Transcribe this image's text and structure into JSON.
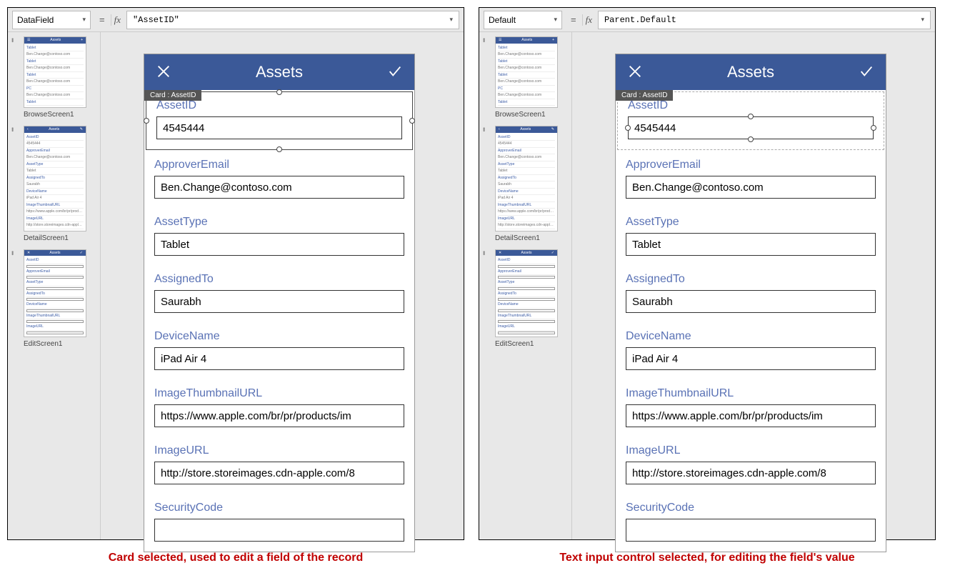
{
  "left": {
    "property": "DataField",
    "formula": "\"AssetID\"",
    "card_tag": "Card : AssetID",
    "selection_mode": "card"
  },
  "right": {
    "property": "Default",
    "formula": "Parent.Default",
    "card_tag": "Card : AssetID",
    "selection_mode": "input"
  },
  "phone": {
    "title": "Assets",
    "fields": [
      {
        "label": "AssetID",
        "value": "4545444"
      },
      {
        "label": "ApproverEmail",
        "value": "Ben.Change@contoso.com"
      },
      {
        "label": "AssetType",
        "value": "Tablet"
      },
      {
        "label": "AssignedTo",
        "value": "Saurabh"
      },
      {
        "label": "DeviceName",
        "value": "iPad Air 4"
      },
      {
        "label": "ImageThumbnailURL",
        "value": "https://www.apple.com/br/pr/products/im"
      },
      {
        "label": "ImageURL",
        "value": "http://store.storeimages.cdn-apple.com/8"
      },
      {
        "label": "SecurityCode",
        "value": ""
      }
    ]
  },
  "thumbs": {
    "browse_label": "BrowseScreen1",
    "detail_label": "DetailScreen1",
    "edit_label": "EditScreen1",
    "title": "Assets",
    "browse_items": [
      "Tablet",
      "Tablet",
      "Tablet",
      "PC",
      "Tablet"
    ]
  },
  "captions": {
    "left": "Card selected, used to edit a field of the record",
    "right": "Text input control selected, for editing the field's value"
  }
}
